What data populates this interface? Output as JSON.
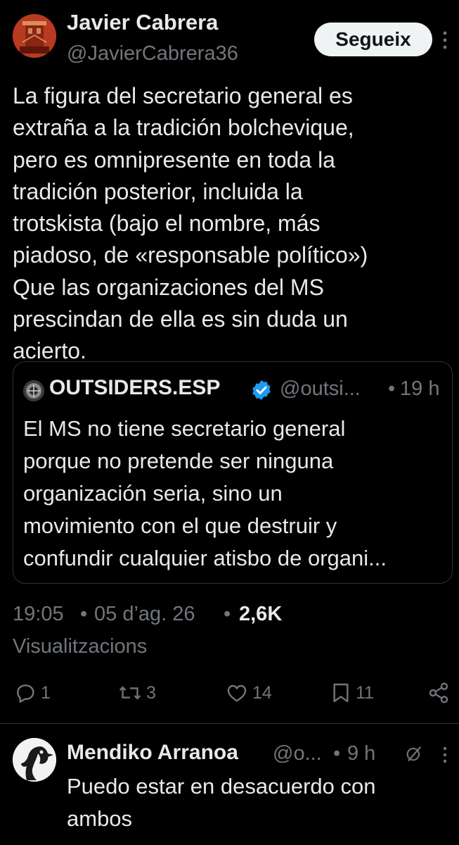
{
  "tweet": {
    "author_name": "Javier Cabrera",
    "author_handle": "@JavierCabrera36",
    "follow_label": "Segueix",
    "text": "La figura del secretario general es\nextraña a la tradición bolchevique,\npero es omnipresente en toda la\ntradición posterior, incluida la\ntrotskista (bajo el nombre, más\npiadoso, de «responsable político»)\nQue las organizaciones del MS\nprescindan de ella es sin duda un\nacierto.",
    "time": "19:05",
    "separator": "•",
    "date": "05 d’ag. 26",
    "views": "2,6K",
    "views_label": "Visualitzacions"
  },
  "quote": {
    "author_name": "OUTSIDERS.ESP",
    "author_handle": "@outsi...",
    "separator": "•",
    "time": "19 h",
    "verified_icon": "verified-badge-icon",
    "verified_color": "#1d9bf0",
    "text": "El MS no tiene secretario general\nporque  no pretende ser ninguna\norganización seria, sino un\nmovimiento con el que destruir y\nconfundir cualquier atisbo de organi..."
  },
  "actions": {
    "reply_count": "1",
    "retweet_count": "3",
    "like_count": "14",
    "bookmark_count": "11",
    "icons": [
      "reply-icon",
      "retweet-icon",
      "like-icon",
      "bookmark-icon",
      "share-icon"
    ]
  },
  "reply": {
    "author_name": "Mendiko Arranoa",
    "author_handle": "@o...",
    "separator": "•",
    "time": "9 h",
    "text": "Puedo estar en desacuerdo con\nambos"
  },
  "colors": {
    "background": "#000000",
    "text_primary": "#e7e9ea",
    "text_secondary": "#71767b",
    "border": "#2f3336",
    "follow_bg": "#eff3f4"
  }
}
